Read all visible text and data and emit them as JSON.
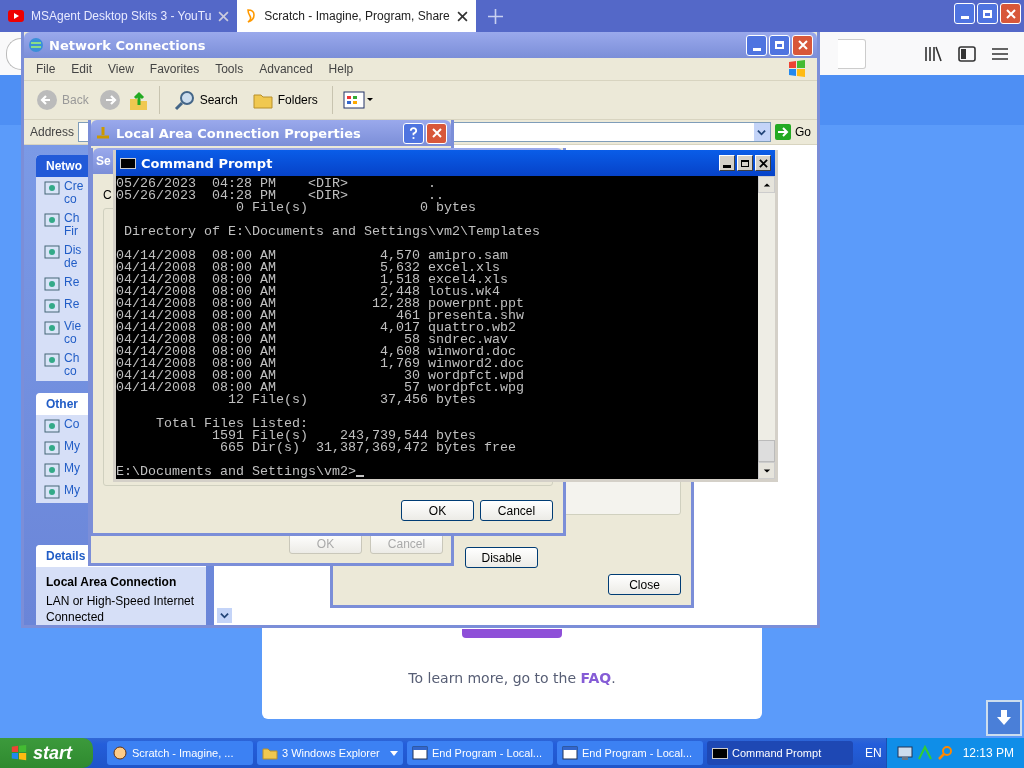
{
  "browser": {
    "tabs": [
      {
        "label": "MSAgent Desktop Skits 3 - YouTu",
        "selected": false,
        "kind": "video"
      },
      {
        "label": "Scratch - Imagine, Program, Share",
        "selected": true,
        "kind": "scratch"
      }
    ]
  },
  "scratch_page": {
    "note": {
      "text": "To learn more, go to the",
      "link": "FAQ",
      "end": "."
    }
  },
  "explorer": {
    "title": "Network Connections",
    "menu": [
      "File",
      "Edit",
      "View",
      "Favorites",
      "Tools",
      "Advanced",
      "Help"
    ],
    "toolbar": [
      {
        "kind": "back",
        "label": "Back",
        "disabled": true
      },
      {
        "kind": "search",
        "label": "Search",
        "disabled": false
      },
      {
        "kind": "folders",
        "label": "Folders",
        "disabled": false
      }
    ],
    "address_label": "Address",
    "go": "Go",
    "sections": [
      {
        "title": "Netwo",
        "items": [
          {
            "lines": [
              "Cre",
              "co"
            ]
          },
          {
            "lines": [
              "Ch",
              "Fir"
            ]
          },
          {
            "lines": [
              "Dis",
              "de"
            ]
          },
          {
            "lines": [
              "Re"
            ]
          },
          {
            "lines": [
              "Re"
            ]
          },
          {
            "lines": [
              "Vie",
              "co"
            ]
          },
          {
            "lines": [
              "Ch",
              "co"
            ]
          }
        ]
      },
      {
        "title": "Other",
        "items": [
          {
            "lines": [
              "Co"
            ]
          },
          {
            "lines": [
              "My"
            ]
          },
          {
            "lines": [
              "My"
            ]
          },
          {
            "lines": [
              "My"
            ]
          }
        ]
      }
    ],
    "details": {
      "title": "Details",
      "name": "Local Area Connection",
      "lines": [
        "LAN or High-Speed Internet",
        "Connected"
      ]
    }
  },
  "properties_dialog": {
    "title": "Local Area Connection Properties",
    "buttons": [
      {
        "label": "OK",
        "disabled": true
      },
      {
        "label": "Cancel",
        "disabled": true
      }
    ]
  },
  "second_dialog": {
    "title": "Se",
    "label": "C",
    "buttons": [
      {
        "label": "OK",
        "disabled": false
      },
      {
        "label": "Cancel",
        "disabled": false
      }
    ]
  },
  "status_dialog": {
    "buttons": [
      {
        "label": "Disable",
        "disabled": false
      },
      {
        "label": "Close",
        "disabled": false
      }
    ]
  },
  "command_prompt": {
    "title": "Command Prompt",
    "blocks": [
      [
        "05/26/2023  04:28 PM    <DIR>          .",
        "05/26/2023  04:28 PM    <DIR>          ..",
        "               0 File(s)              0 bytes"
      ],
      [
        " Directory of E:\\Documents and Settings\\vm2\\Templates"
      ],
      [
        "04/14/2008  08:00 AM             4,570 amipro.sam",
        "04/14/2008  08:00 AM             5,632 excel.xls",
        "04/14/2008  08:00 AM             1,518 excel4.xls",
        "04/14/2008  08:00 AM             2,448 lotus.wk4",
        "04/14/2008  08:00 AM            12,288 powerpnt.ppt",
        "04/14/2008  08:00 AM               461 presenta.shw",
        "04/14/2008  08:00 AM             4,017 quattro.wb2",
        "04/14/2008  08:00 AM                58 sndrec.wav",
        "04/14/2008  08:00 AM             4,608 winword.doc",
        "04/14/2008  08:00 AM             1,769 winword2.doc",
        "04/14/2008  08:00 AM                30 wordpfct.wpd",
        "04/14/2008  08:00 AM                57 wordpfct.wpg",
        "              12 File(s)         37,456 bytes"
      ],
      [
        "     Total Files Listed:",
        "            1591 File(s)    243,739,544 bytes",
        "             665 Dir(s)  31,387,369,472 bytes free"
      ]
    ],
    "prompt": "E:\\Documents and Settings\\vm2>"
  },
  "taskbar": {
    "start": "start",
    "items": [
      {
        "kind": "browser",
        "label": "Scratch - Imagine, ...",
        "selected": false,
        "dropdown": false
      },
      {
        "kind": "folder",
        "label": "3 Windows Explorer",
        "selected": false,
        "dropdown": true
      },
      {
        "kind": "window",
        "label": "End Program - Local...",
        "selected": false,
        "dropdown": false
      },
      {
        "kind": "window",
        "label": "End Program - Local...",
        "selected": false,
        "dropdown": false
      },
      {
        "kind": "console",
        "label": "Command Prompt",
        "selected": true,
        "dropdown": false
      }
    ],
    "language": "EN",
    "time": "12:13 PM"
  }
}
